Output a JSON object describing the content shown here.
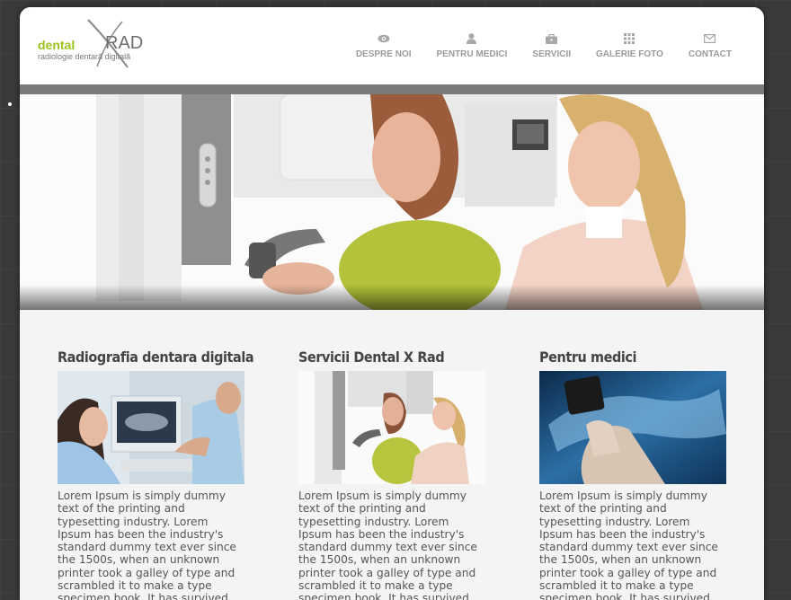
{
  "logo": {
    "word": "dental",
    "rad": "RAD",
    "tagline": "radiologie dentară digitală"
  },
  "nav": [
    {
      "label": "DESPRE NOI",
      "icon": "eye-icon"
    },
    {
      "label": "PENTRU MEDICI",
      "icon": "user-icon"
    },
    {
      "label": "SERVICII",
      "icon": "briefcase-icon"
    },
    {
      "label": "GALERIE FOTO",
      "icon": "grid-icon"
    },
    {
      "label": "CONTACT",
      "icon": "envelope-icon"
    }
  ],
  "columns": [
    {
      "title": "Radiografia dentara digitala",
      "text": "Lorem Ipsum is simply dummy text of the printing and typesetting industry. Lorem Ipsum has been the industry's standard dummy text ever since the 1500s, when an unknown printer took a galley of type and scrambled it to make a type specimen book. It has survived not"
    },
    {
      "title": "Servicii Dental X Rad",
      "text": "Lorem Ipsum is simply dummy text of the printing and typesetting industry. Lorem Ipsum has been the industry's standard dummy text ever since the 1500s, when an unknown printer took a galley of type and scrambled it to make a type specimen book. It has survived not"
    },
    {
      "title": "Pentru medici",
      "text": "Lorem Ipsum is simply dummy text of the printing and typesetting industry. Lorem Ipsum has been the industry's standard dummy text ever since the 1500s, when an unknown printer took a galley of type and scrambled it to make a type specimen book. It has survived not"
    }
  ],
  "colors": {
    "brand_green": "#9cc31e",
    "nav_text": "#9a9a9a",
    "band": "#7b7b7b"
  }
}
